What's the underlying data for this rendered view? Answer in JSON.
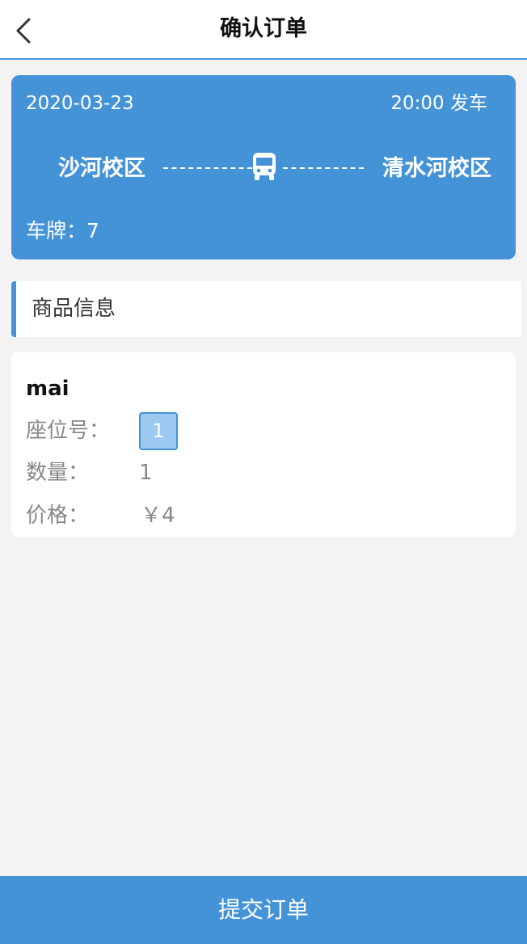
{
  "header": {
    "title": "确认订单",
    "back_icon": "chevron-left-icon"
  },
  "trip": {
    "date": "2020-03-23",
    "departure": "20:00 发车",
    "from": "沙河校区",
    "to": "清水河校区",
    "plate_label": "车牌：",
    "plate_value": "7",
    "bus_icon": "bus-icon"
  },
  "section": {
    "title": "商品信息"
  },
  "goods": {
    "name": "mai",
    "seat_label": "座位号：",
    "seat_value": "1",
    "quantity_label": "数量：",
    "quantity_value": "1",
    "price_label": "价格：",
    "price_value": "￥4"
  },
  "footer": {
    "submit_label": "提交订单"
  },
  "colors": {
    "accent": "#4493d6",
    "seat_fill": "#9cc9ef",
    "background": "#f3f3f3"
  }
}
